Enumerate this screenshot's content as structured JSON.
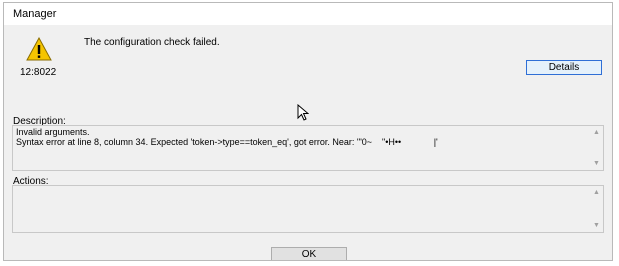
{
  "window": {
    "title": "Manager"
  },
  "header": {
    "icon": "warning-triangle-icon",
    "error_code": "12:8022",
    "message": "The configuration check failed.",
    "details_label": "Details"
  },
  "description": {
    "label": "Description:",
    "text": "Invalid arguments.\nSyntax error at line 8, column 34. Expected 'token->type==token_eq', got error. Near: '\"0~    \"•H••             |'"
  },
  "actions": {
    "label": "Actions:",
    "text": ""
  },
  "footer": {
    "ok_label": "OK"
  },
  "colors": {
    "dialog_bg": "#f0f0f0",
    "details_border": "#2f6fd6",
    "warning_fill": "#f5c400"
  }
}
